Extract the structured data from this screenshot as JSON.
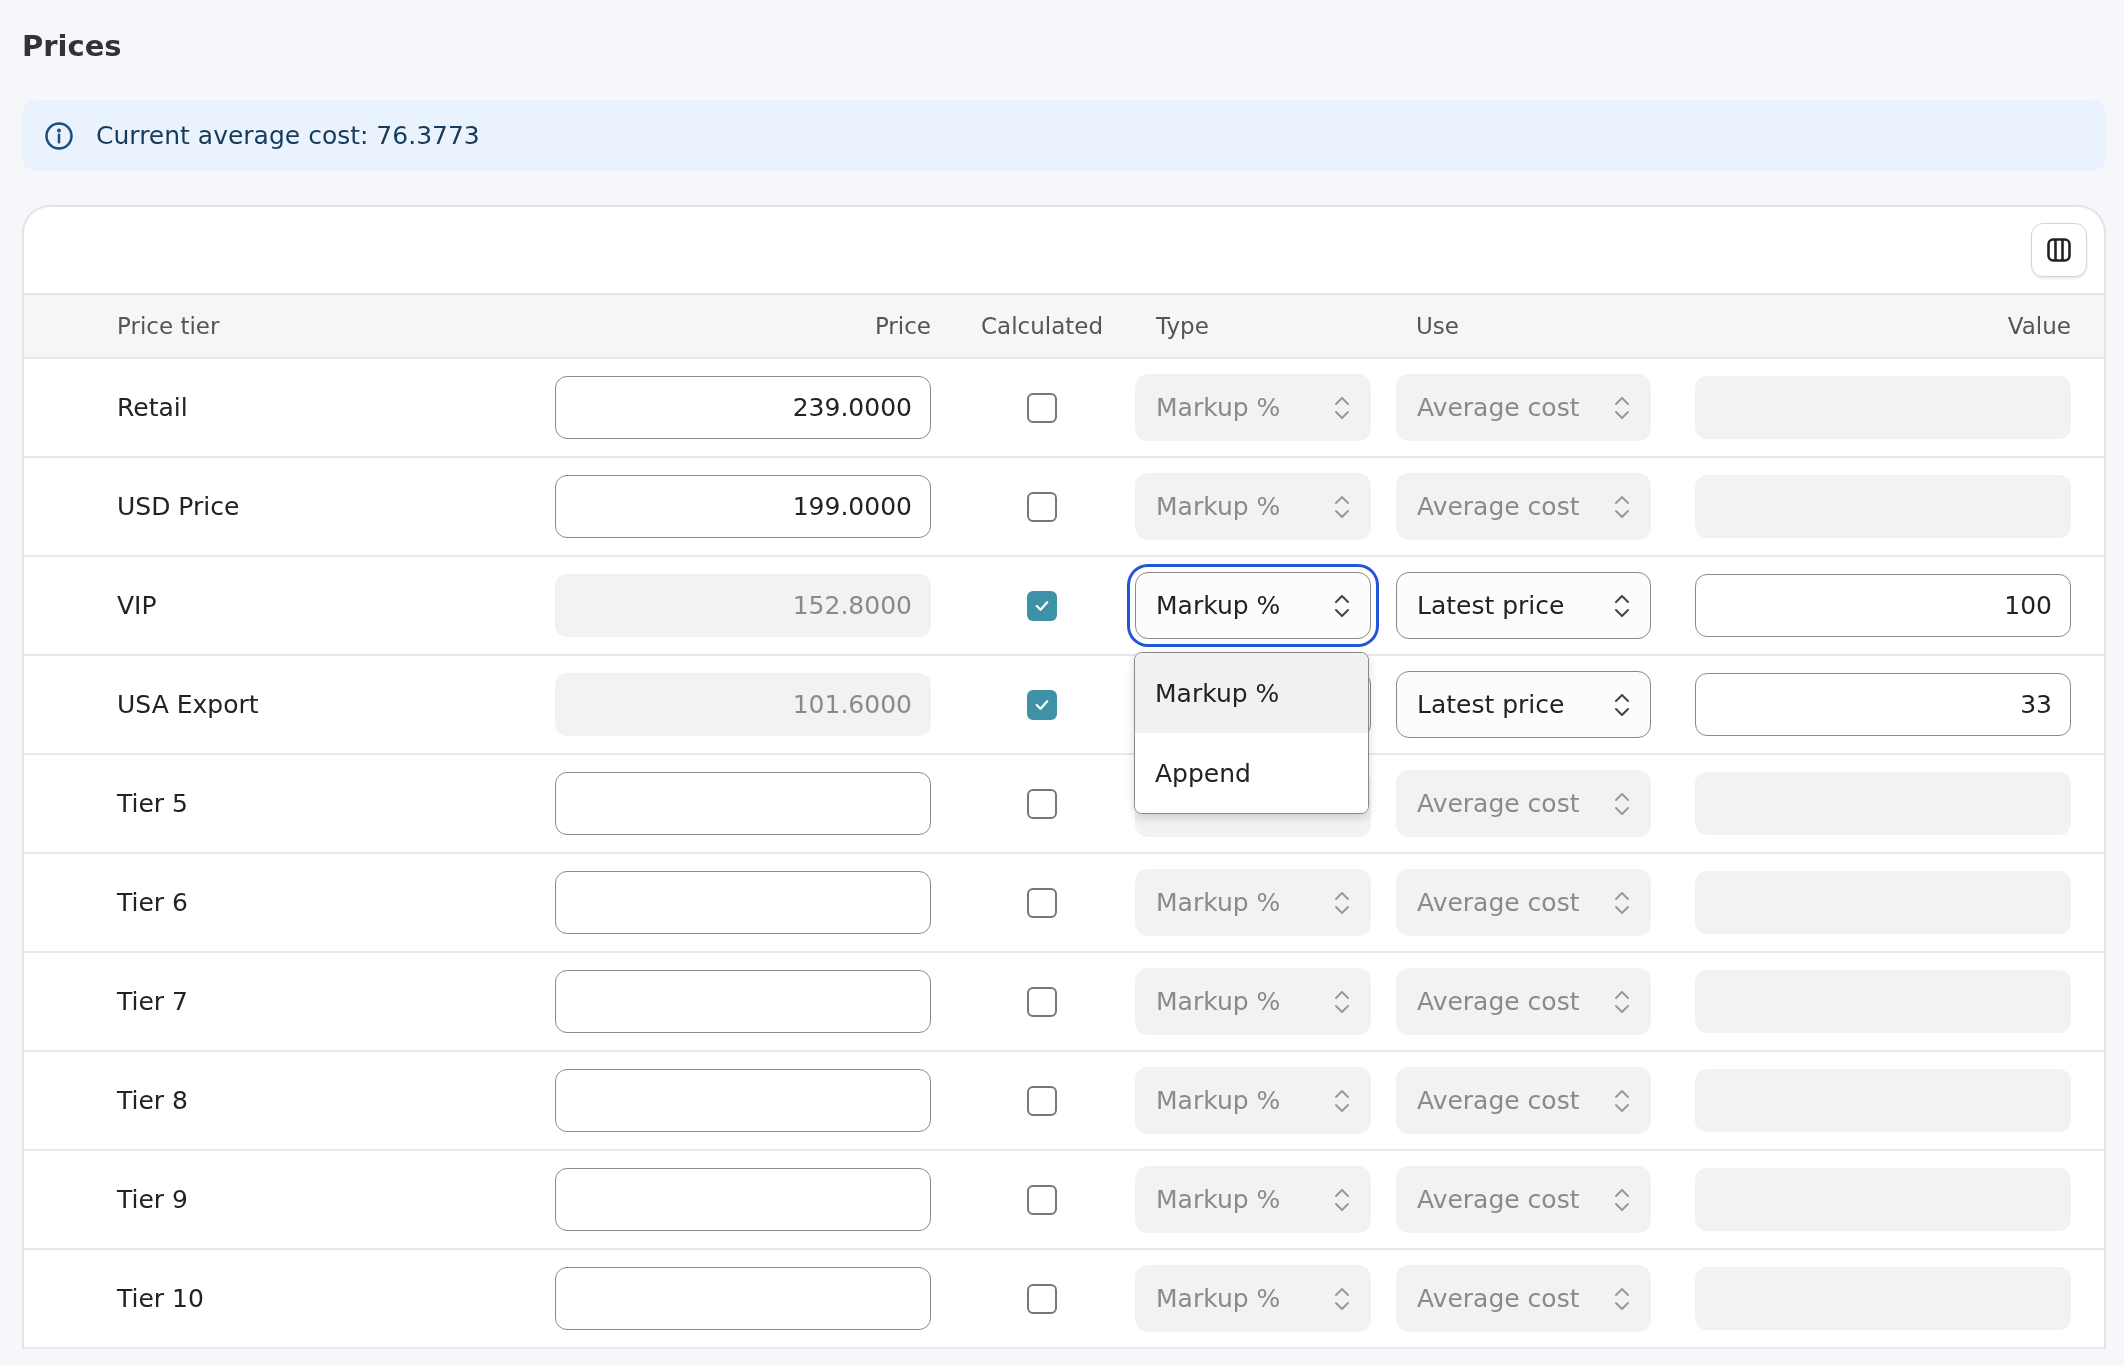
{
  "title": "Prices",
  "notice": {
    "text": "Current average cost: 76.3773"
  },
  "table": {
    "columns": [
      "Price tier",
      "Price",
      "Calculated",
      "Type",
      "Use",
      "Value"
    ],
    "rows": [
      {
        "tier": "Retail",
        "price": "239.0000",
        "calculated": false,
        "type": "Markup %",
        "use": "Average cost",
        "focused": false
      },
      {
        "tier": "USD Price",
        "price": "199.0000",
        "calculated": false,
        "type": "Markup %",
        "use": "Average cost",
        "focused": false
      },
      {
        "tier": "VIP",
        "price": "152.8000",
        "calculated": true,
        "type": "Markup %",
        "use": "Latest price",
        "value": "100",
        "focused": true
      },
      {
        "tier": "USA Export",
        "price": "101.6000",
        "calculated": true,
        "use": "Latest price",
        "value": "33",
        "focused": false
      },
      {
        "tier": "Tier 5",
        "calculated": false,
        "use": "Average cost",
        "focused": false
      },
      {
        "tier": "Tier 6",
        "calculated": false,
        "type": "Markup %",
        "use": "Average cost",
        "focused": false
      },
      {
        "tier": "Tier 7",
        "calculated": false,
        "type": "Markup %",
        "use": "Average cost",
        "focused": false
      },
      {
        "tier": "Tier 8",
        "calculated": false,
        "type": "Markup %",
        "use": "Average cost",
        "focused": false
      },
      {
        "tier": "Tier 9",
        "calculated": false,
        "type": "Markup %",
        "use": "Average cost",
        "focused": false
      },
      {
        "tier": "Tier 10",
        "calculated": false,
        "type": "Markup %",
        "use": "Average cost",
        "focused": false
      }
    ]
  },
  "type_menu": {
    "options": [
      {
        "label": "Markup %",
        "selected": true
      },
      {
        "label": "Append",
        "selected": false
      }
    ]
  }
}
